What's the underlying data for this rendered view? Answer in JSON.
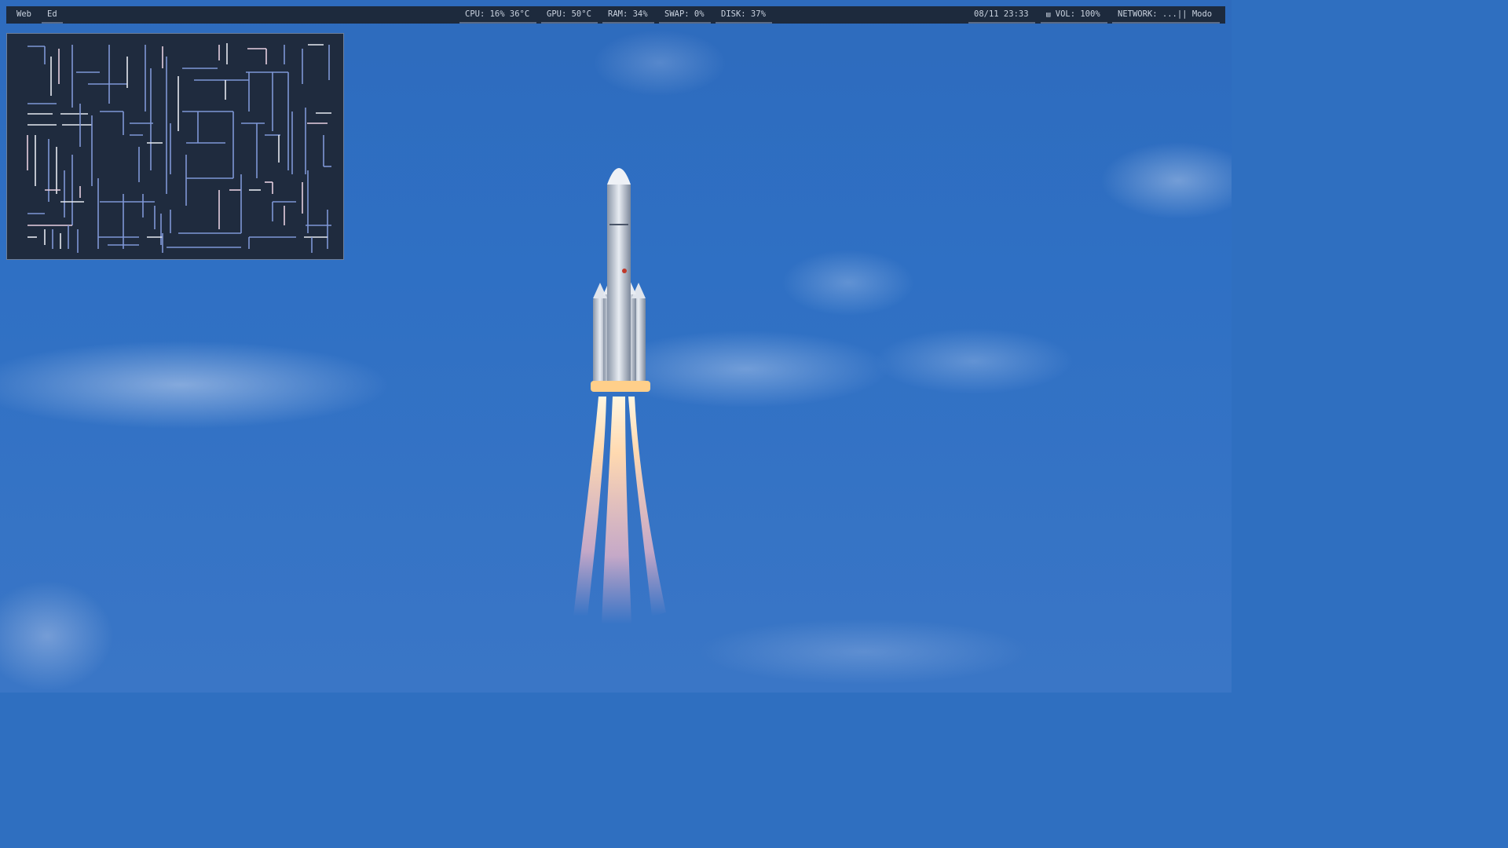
{
  "wallpaper": {
    "description_icon": "rocket-launch-icon",
    "colors": {
      "sky": "#2f6fc0",
      "flame": "#ffd9b0"
    }
  },
  "statusbar": {
    "workspaces": [
      {
        "label": "Web",
        "active": false
      },
      {
        "label": "Ed",
        "active": true
      }
    ],
    "cpu": "CPU: 16% 36°C",
    "gpu": "GPU: 50°C",
    "ram": "RAM: 34%",
    "swap": "SWAP: 0%",
    "disk": "DISK: 37%",
    "datetime": "08/11 23:33",
    "volume_icon": "speaker-icon",
    "volume_glyph": "▤",
    "volume": "VOL: 100%",
    "network": "NETWORK: ...|| Modo",
    "colors": {
      "background": "#1d2a3d",
      "text": "#c9d2df",
      "underline": "#5b6b86"
    }
  },
  "terminal": {
    "program_icon": "pipes-screensaver-icon",
    "colors": {
      "background": "#1f2b3e",
      "border": "#6e7f99",
      "pipe_blue": "#7f97d6",
      "pipe_pink": "#e7cfe0",
      "pipe_white": "#e6e9f0"
    }
  }
}
